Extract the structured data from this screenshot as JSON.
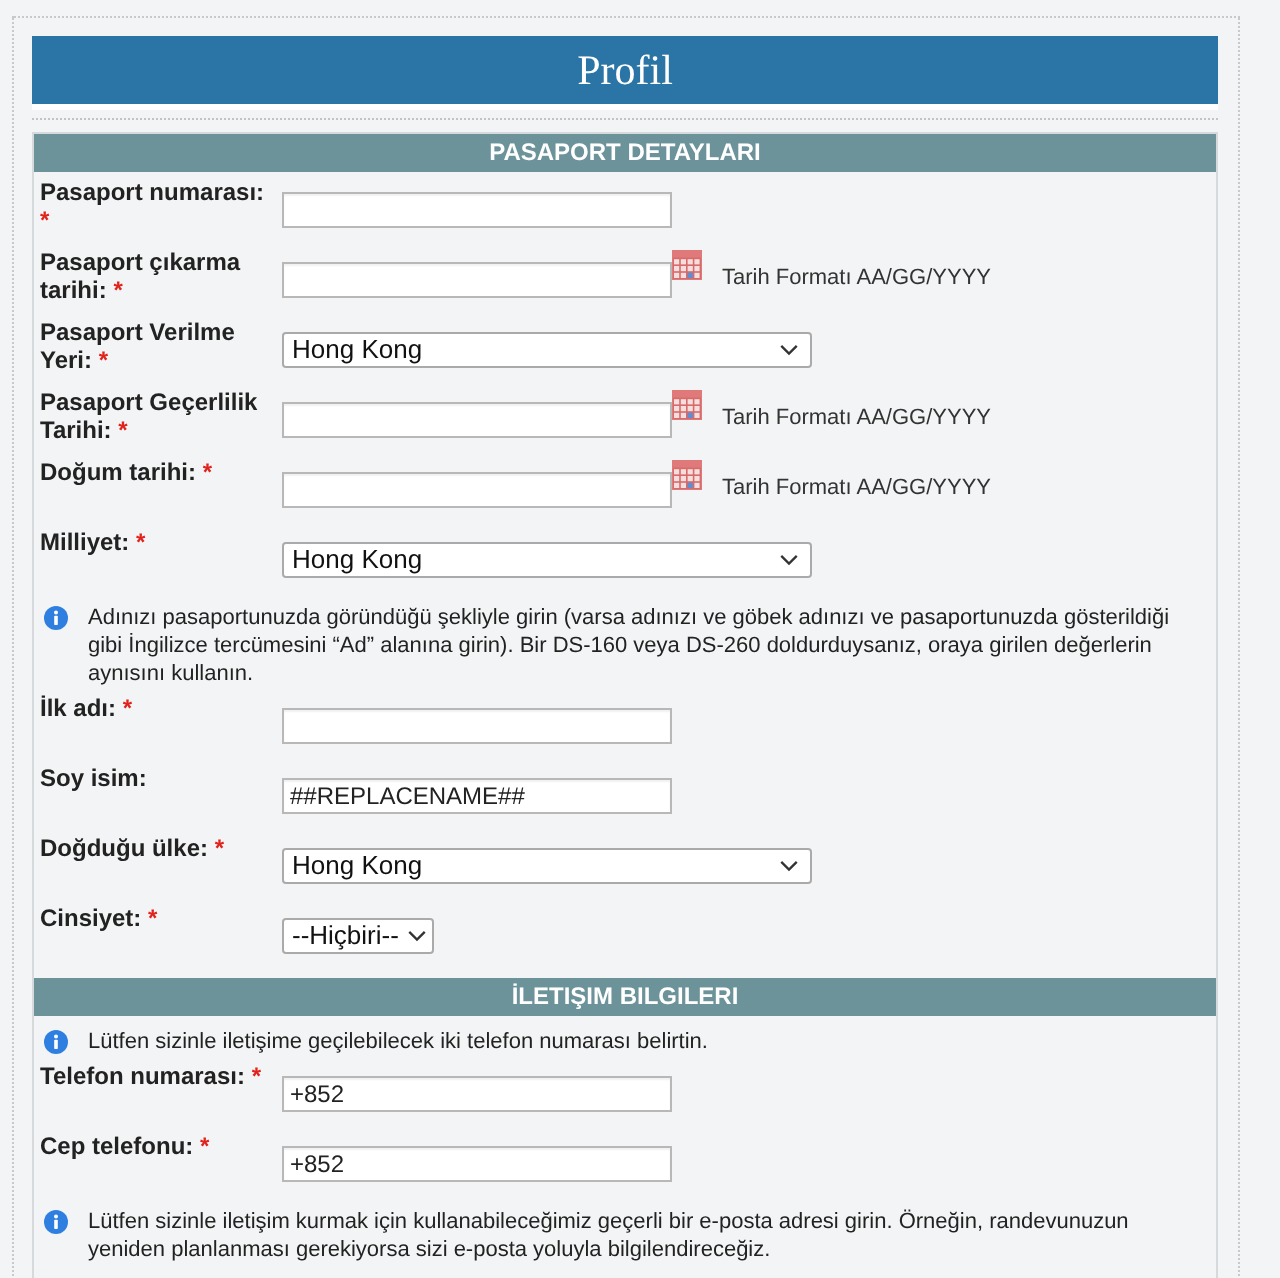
{
  "title": "Profil",
  "sections": [
    {
      "heading": "PASAPORT DETAYLARI",
      "items": [
        {
          "kind": "text",
          "label": "Pasaport numarası:",
          "required_mark": "*"
        },
        {
          "kind": "date",
          "label": "Pasaport çıkarma tarihi:",
          "required_mark": "*",
          "hint": "Tarih Formatı AA/GG/YYYY"
        },
        {
          "kind": "select",
          "label": "Pasaport Verilme Yeri:",
          "required_mark": "*",
          "value": "Hong Kong"
        },
        {
          "kind": "date",
          "label": "Pasaport Geçerlilik Tarihi:",
          "required_mark": "*",
          "hint": "Tarih Formatı AA/GG/YYYY"
        },
        {
          "kind": "date",
          "label": "Doğum tarihi:",
          "required_mark": "*",
          "hint": "Tarih Formatı AA/GG/YYYY"
        },
        {
          "kind": "select",
          "label": "Milliyet:",
          "required_mark": "*",
          "value": "Hong Kong"
        },
        {
          "kind": "info",
          "text": "Adınızı pasaportunuzda göründüğü şekliyle girin (varsa adınızı ve göbek adınızı ve pasaportunuzda gösterildiği gibi İngilizce tercümesini “Ad” alanına girin). Bir DS-160 veya DS-260 doldurduysanız, oraya girilen değerlerin aynısını kullanın."
        },
        {
          "kind": "text",
          "label": "İlk adı:",
          "required_mark": "*"
        },
        {
          "kind": "text",
          "label": "Soy isim:",
          "value": "##REPLACENAME##"
        },
        {
          "kind": "select",
          "label": "Doğduğu ülke:",
          "required_mark": "*",
          "value": "Hong Kong"
        },
        {
          "kind": "short_select",
          "label": "Cinsiyet:",
          "required_mark": "*",
          "value": "--Hiçbiri--"
        }
      ]
    },
    {
      "heading": "İLETIŞIM BILGILERI",
      "items": [
        {
          "kind": "info",
          "text": "Lütfen sizinle iletişime geçilebilecek iki telefon numarası belirtin."
        },
        {
          "kind": "text",
          "label": "Telefon numarası:",
          "required_mark": "*",
          "value": "+852"
        },
        {
          "kind": "text",
          "label": "Cep telefonu:",
          "required_mark": "*",
          "value": "+852"
        },
        {
          "kind": "info",
          "text": "Lütfen sizinle iletişim kurmak için kullanabileceğimiz geçerli bir e-posta adresi girin. Örneğin, randevunuzun yeniden planlanması gerekiyorsa sizi e-posta yoluyla bilgilendireceğiz."
        }
      ]
    }
  ]
}
